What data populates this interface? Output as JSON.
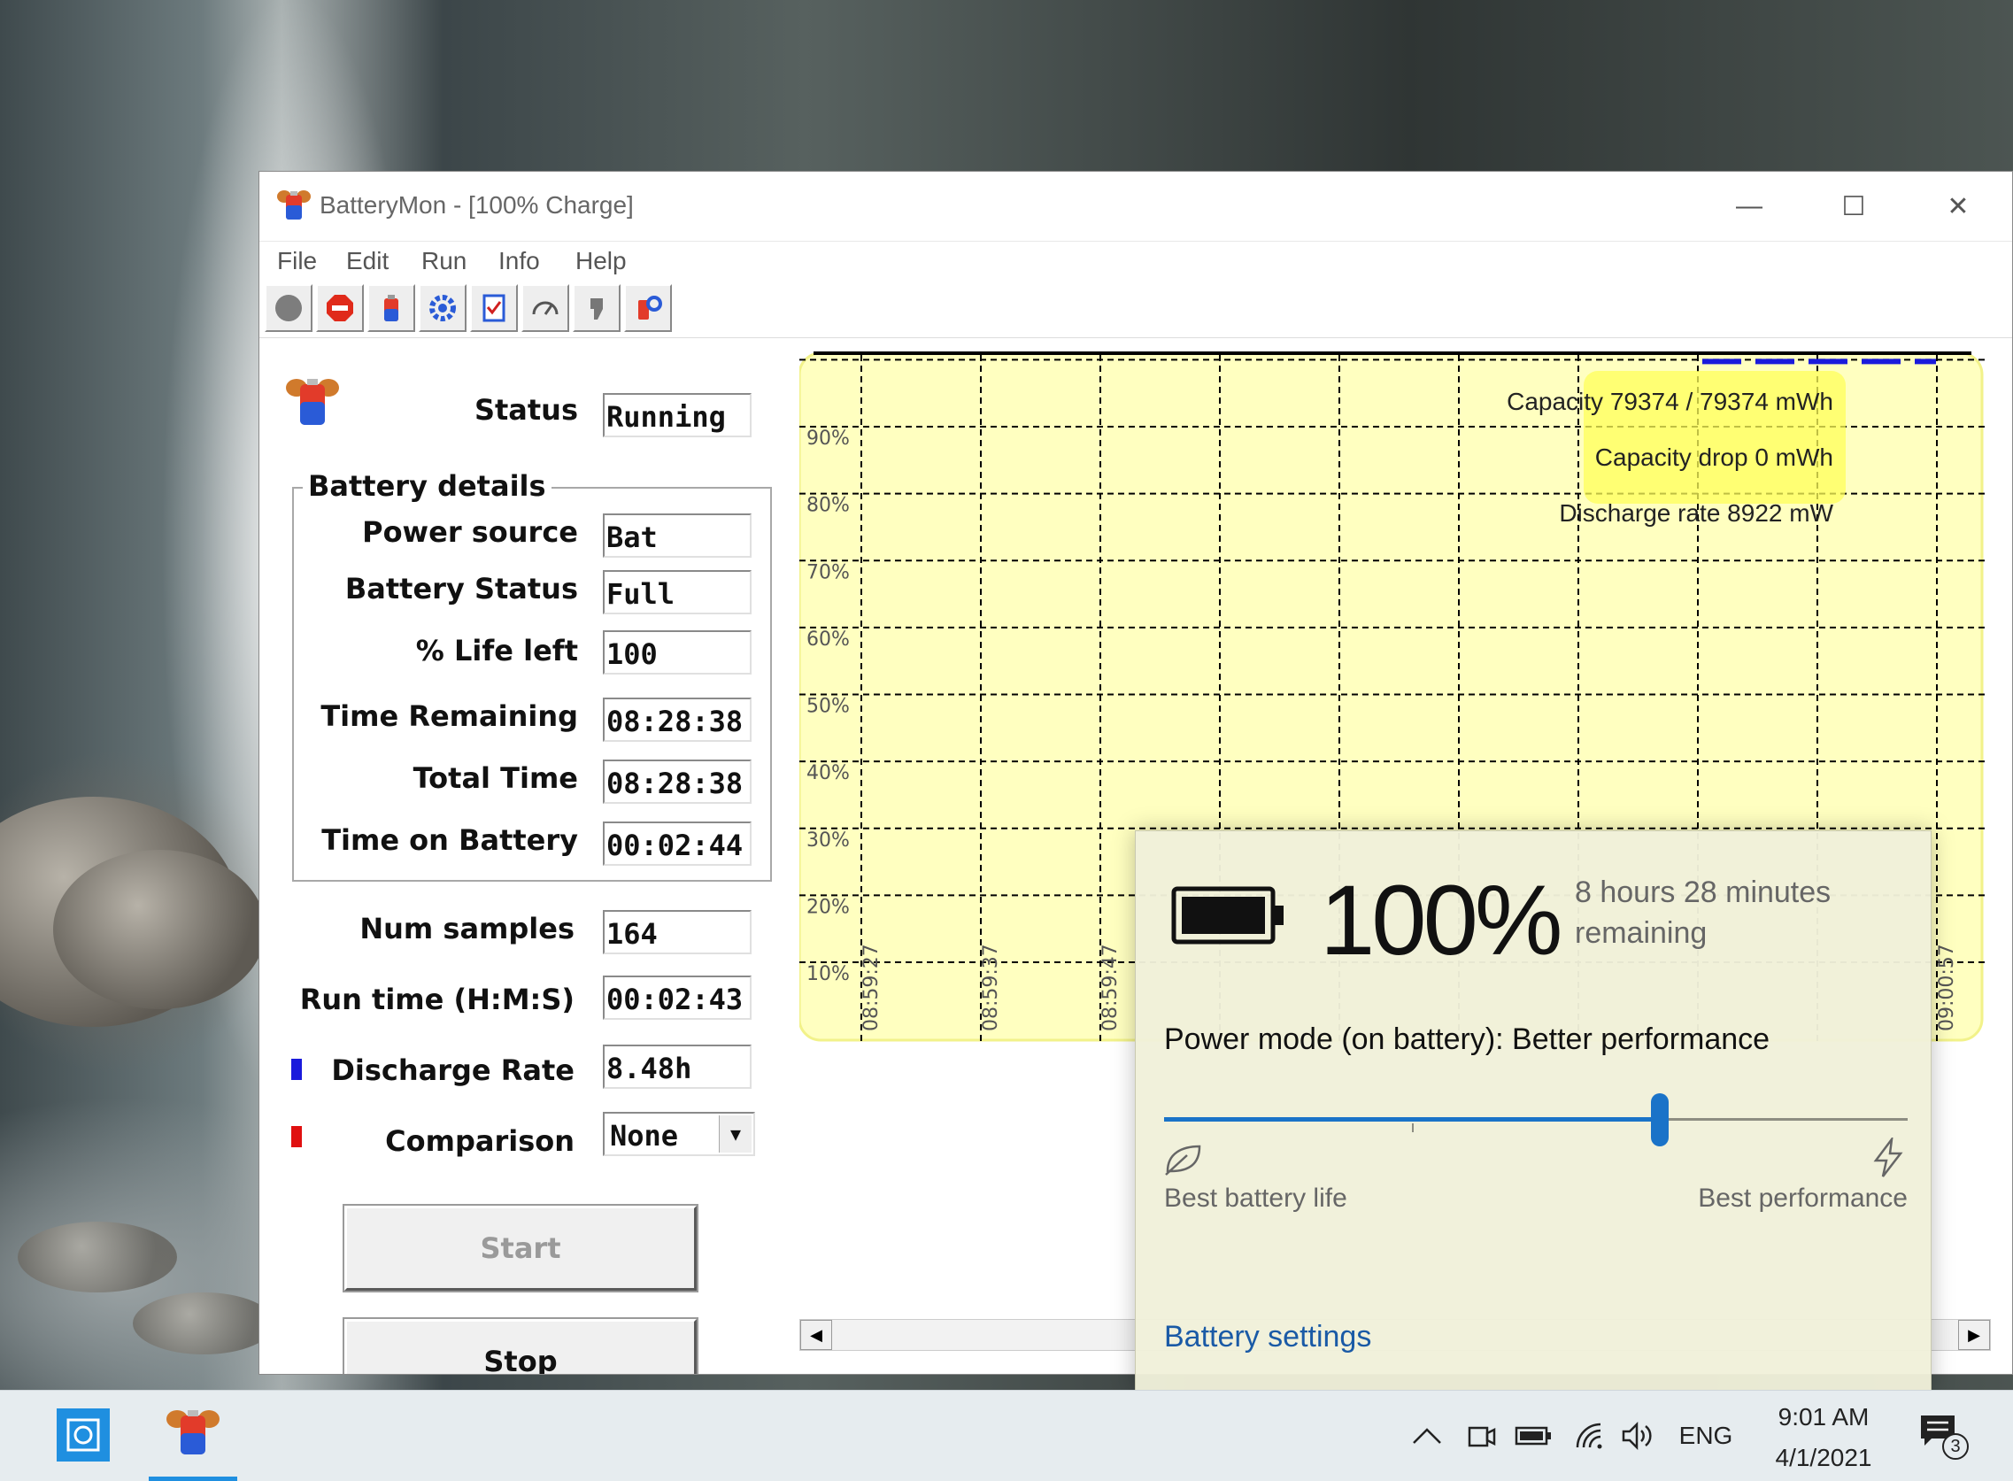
{
  "window": {
    "title": "BatteryMon - [100% Charge]",
    "minimize_glyph": "—",
    "maximize_glyph": "☐",
    "close_glyph": "✕"
  },
  "menu": [
    "File",
    "Edit",
    "Run",
    "Info",
    "Help"
  ],
  "toolbar_icons": [
    "stop-circle-icon",
    "stop-sign-icon",
    "battery-icon",
    "gear-icon",
    "checklist-icon",
    "gauge-icon",
    "plug-icon",
    "settings-icon"
  ],
  "status": {
    "label": "Status",
    "value": "Running"
  },
  "battery_details": {
    "title": "Battery details",
    "rows": [
      {
        "label": "Power source",
        "value": "Bat"
      },
      {
        "label": "Battery Status",
        "value": "Full"
      },
      {
        "label": "% Life left",
        "value": "100"
      },
      {
        "label": "Time Remaining",
        "value": "08:28:38"
      },
      {
        "label": "Total Time",
        "value": "08:28:38"
      },
      {
        "label": "Time on Battery",
        "value": "00:02:44"
      }
    ]
  },
  "stats": {
    "num_samples": {
      "label": "Num samples",
      "value": "164"
    },
    "run_time": {
      "label": "Run time (H:M:S)",
      "value": "00:02:43"
    },
    "discharge_rate": {
      "label": "Discharge Rate",
      "value": "8.48h",
      "color": "#1a1adc"
    },
    "comparison": {
      "label": "Comparison",
      "value": "None",
      "color": "#e01010"
    }
  },
  "buttons": {
    "start": "Start",
    "stop": "Stop"
  },
  "chart_data": {
    "type": "line",
    "y_ticks": [
      "90%",
      "80%",
      "70%",
      "60%",
      "50%",
      "40%",
      "30%",
      "20%",
      "10%"
    ],
    "x_ticks": [
      "08:59:27",
      "08:59:37",
      "08:59:47",
      "09:00:57"
    ],
    "ylim": [
      0,
      100
    ],
    "series": [
      {
        "values": [
          100,
          100,
          100,
          100
        ],
        "color": "#1a1adc"
      }
    ],
    "background": "#ffffc0",
    "grid": true,
    "info": [
      "Capacity 79374 / 79374 mWh",
      "Capacity drop 0 mWh",
      "Discharge rate 8922 mW"
    ]
  },
  "flyout": {
    "percent": "100%",
    "remaining_line1": "8 hours 28 minutes",
    "remaining_line2": "remaining",
    "power_mode": "Power mode (on battery): Better performance",
    "slider_value": 0.667,
    "left_label": "Best battery life",
    "right_label": "Best performance",
    "settings_link": "Battery settings"
  },
  "taskbar": {
    "language": "ENG",
    "time": "9:01 AM",
    "date": "4/1/2021",
    "notification_count": "3"
  }
}
